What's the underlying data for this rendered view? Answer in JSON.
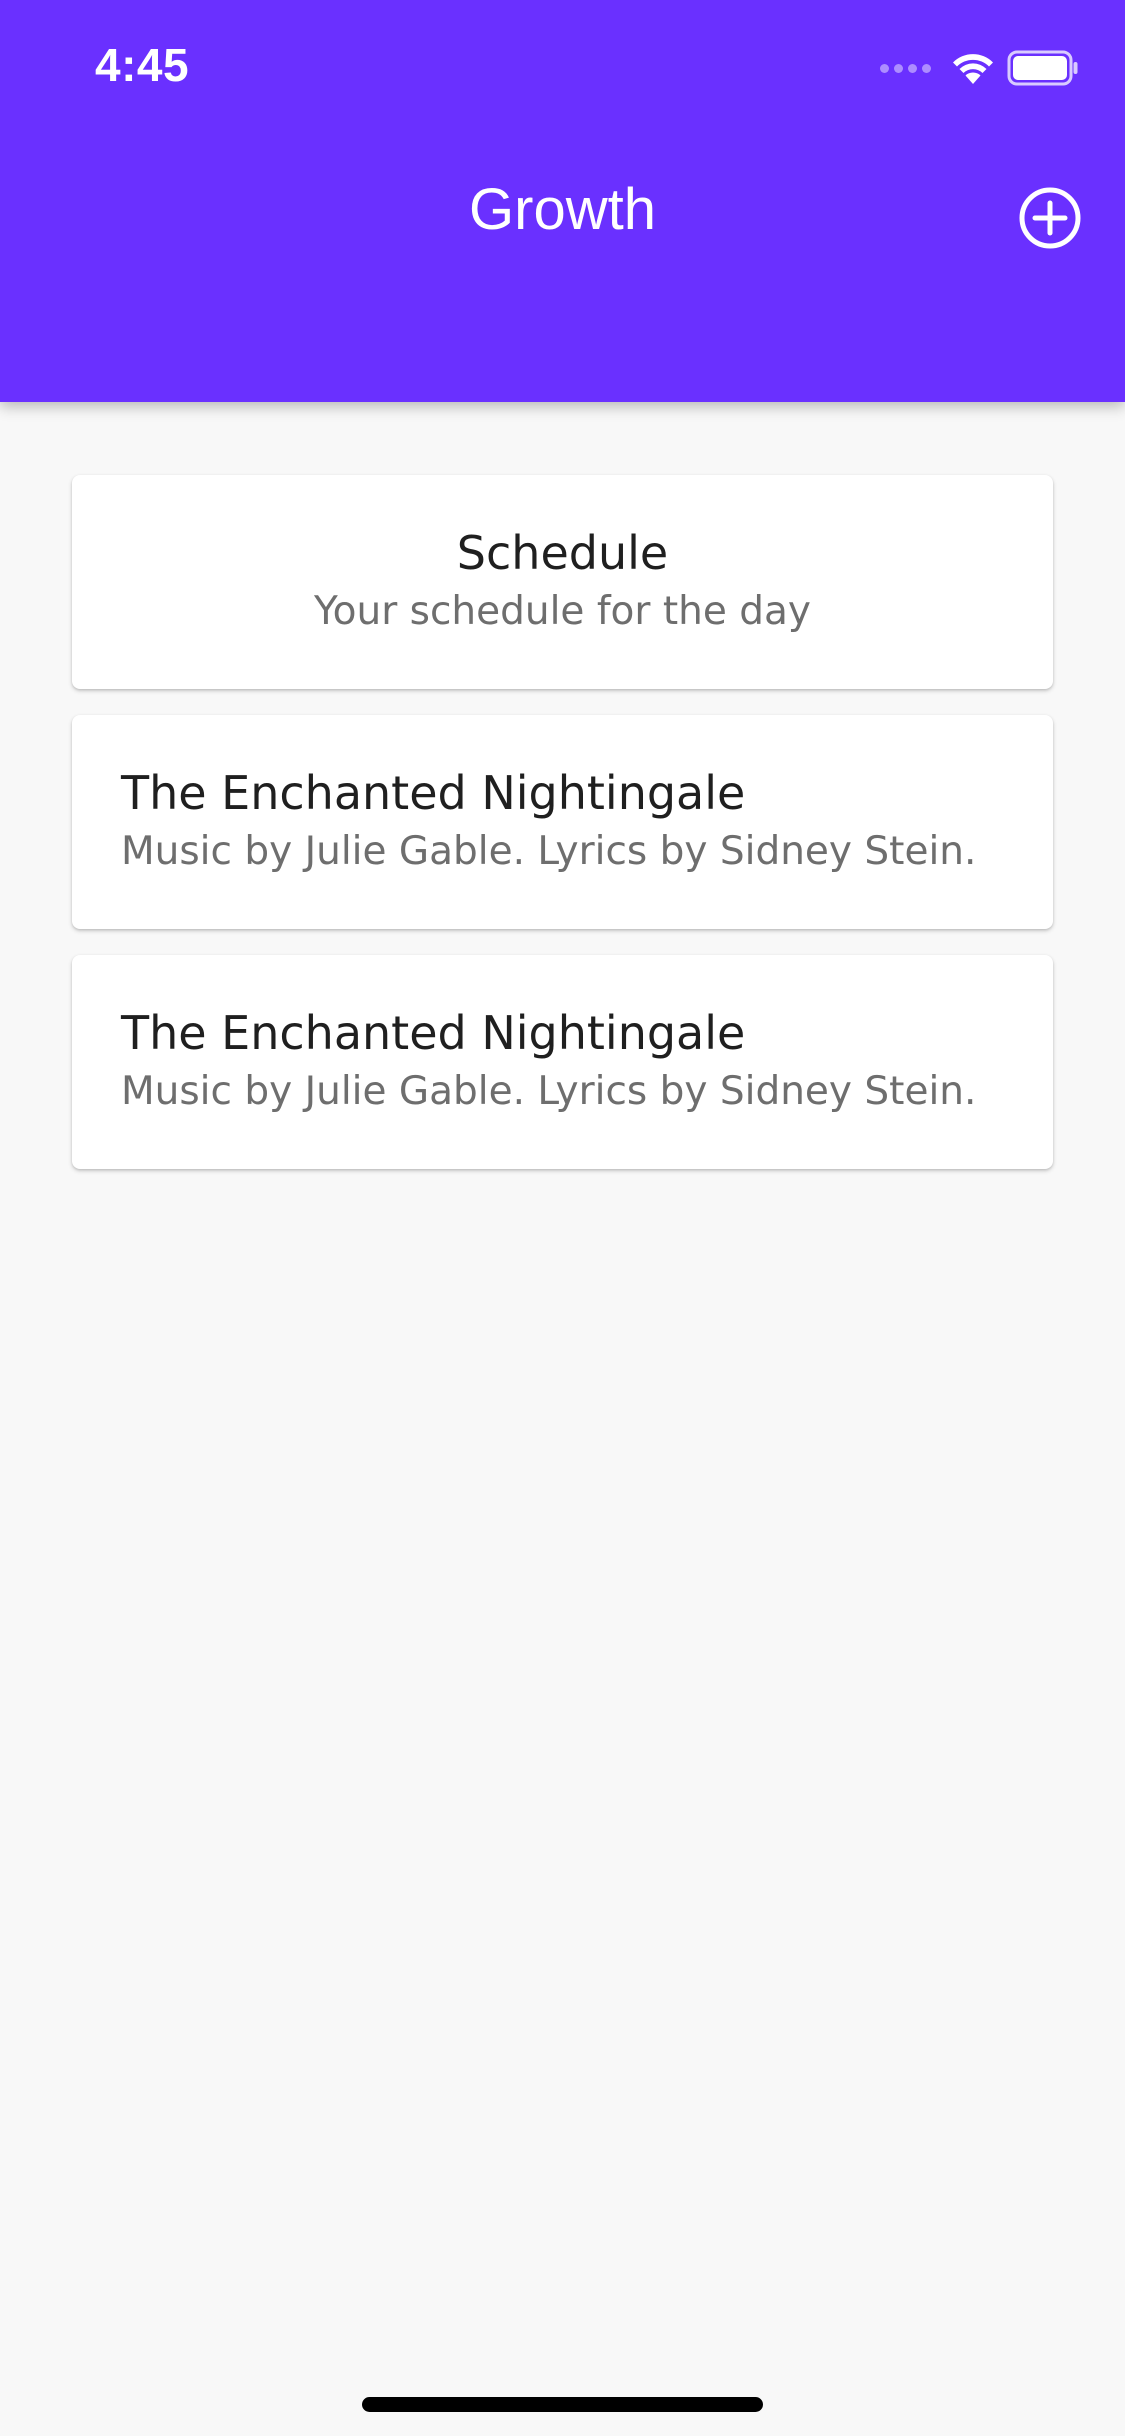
{
  "status_bar": {
    "time": "4:45"
  },
  "app_bar": {
    "title": "Growth",
    "background_color": "#6a30ff",
    "add_icon": "plus-circle-icon"
  },
  "cards": [
    {
      "title": "Schedule",
      "subtitle": "Your schedule for the day"
    },
    {
      "title": "The Enchanted Nightingale",
      "subtitle": "Music by Julie Gable. Lyrics by Sidney Stein."
    },
    {
      "title": "The Enchanted Nightingale",
      "subtitle": "Music by Julie Gable. Lyrics by Sidney Stein."
    }
  ]
}
